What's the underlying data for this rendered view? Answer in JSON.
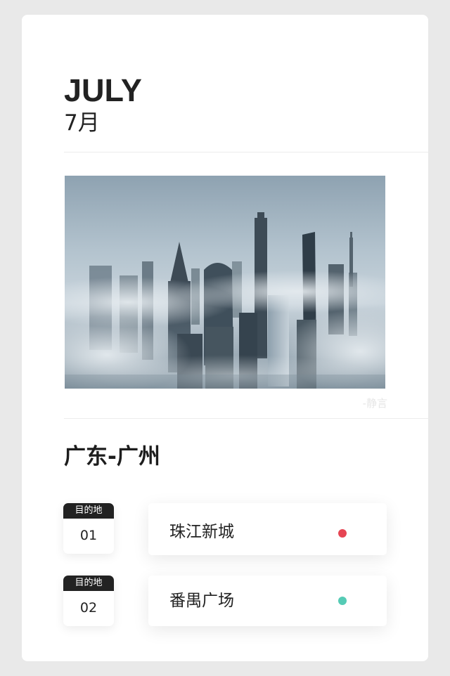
{
  "header": {
    "month_en": "JULY",
    "month_cn": "7月"
  },
  "photo": {
    "credit": "-静言"
  },
  "city": {
    "title": "广东-广州"
  },
  "destinations": [
    {
      "badge_label": "目的地",
      "number": "01",
      "name": "珠江新城",
      "dot_color": "#e64553"
    },
    {
      "badge_label": "目的地",
      "number": "02",
      "name": "番禺广场",
      "dot_color": "#55cbb5"
    }
  ]
}
